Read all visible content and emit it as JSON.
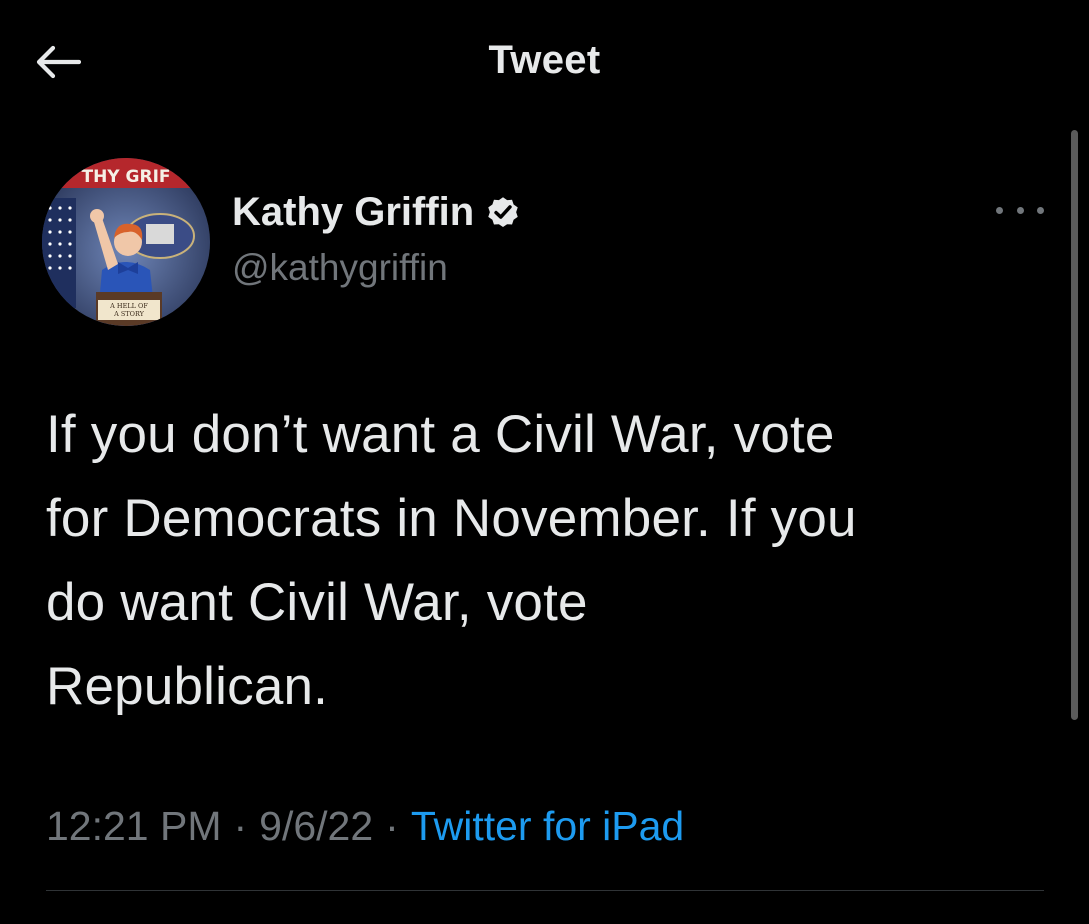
{
  "header": {
    "title": "Tweet",
    "back_icon": "arrow-left-icon"
  },
  "author": {
    "display_name": "Kathy Griffin",
    "handle": "@kathygriffin",
    "verified": true,
    "verified_icon": "verified-badge-icon",
    "avatar_banner_text": "THY GRIF",
    "avatar_caption_line1": "A HELL OF",
    "avatar_caption_line2": "A STORY"
  },
  "tweet": {
    "text": "If you don’t want a Civil War, vote\nfor Democrats in November. If you\ndo want Civil War, vote\nRepublican.",
    "time": "12:21 PM",
    "separator": "·",
    "date": "9/6/22",
    "source": "Twitter for iPad"
  },
  "colors": {
    "background": "#000000",
    "primary_text": "#e7e9ea",
    "secondary_text": "#71767b",
    "link": "#1d9bf0",
    "divider": "#2f3336"
  },
  "more_icon": "more-horizontal-icon"
}
